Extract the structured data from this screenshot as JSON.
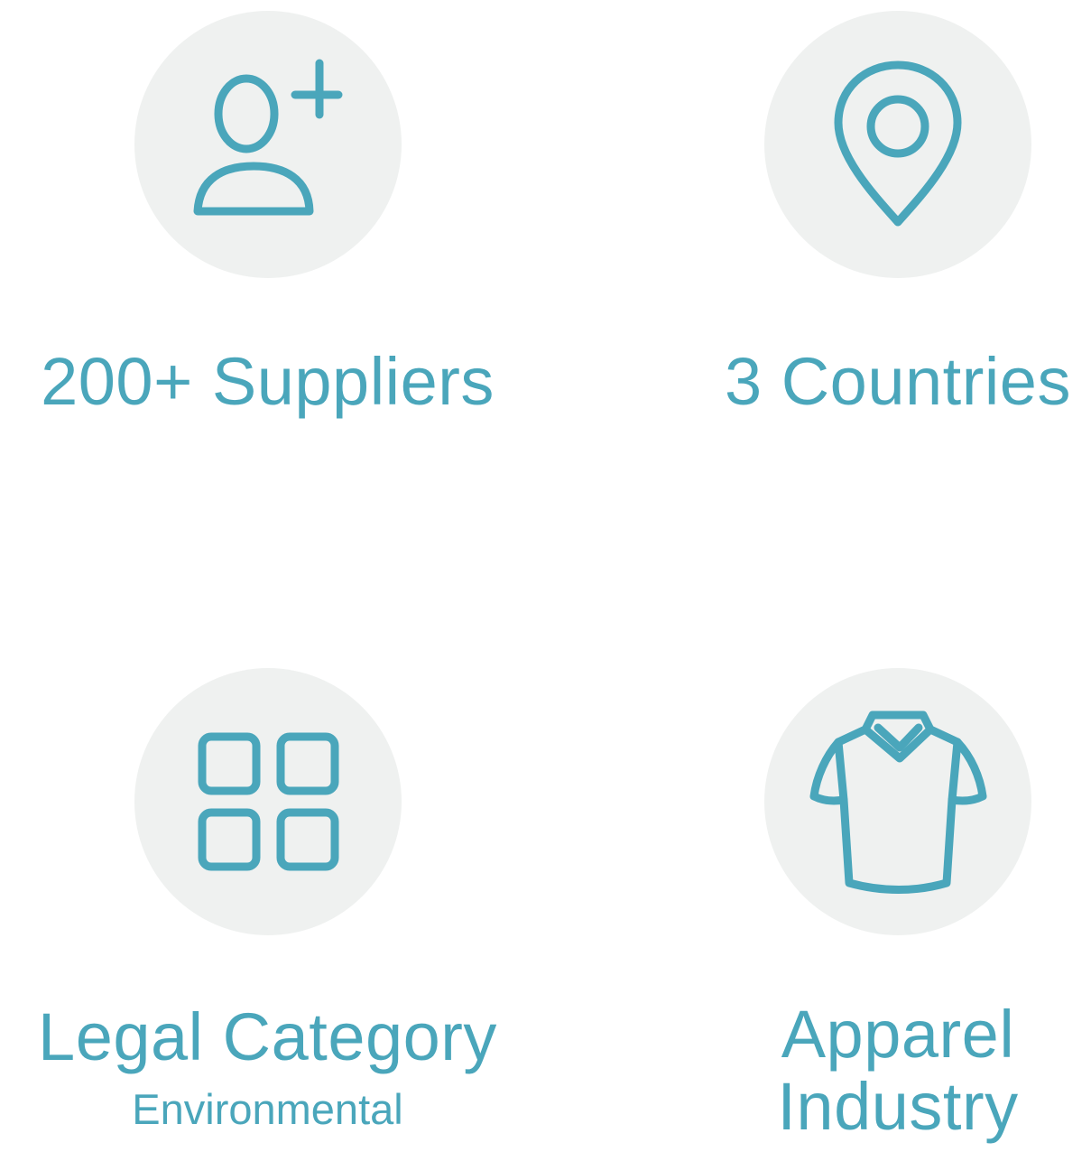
{
  "colors": {
    "accent": "#4aa6bb",
    "circle_bg": "#eff1f0",
    "background": "#ffffff"
  },
  "stats": [
    {
      "icon": "add-user-icon",
      "label": "200+ Suppliers"
    },
    {
      "icon": "location-pin-icon",
      "label": "3 Countries"
    },
    {
      "icon": "grid-icon",
      "label": "Legal Category",
      "sublabel": "Environmental"
    },
    {
      "icon": "shirt-icon",
      "label_line1": "Apparel",
      "label_line2": "Industry"
    }
  ]
}
